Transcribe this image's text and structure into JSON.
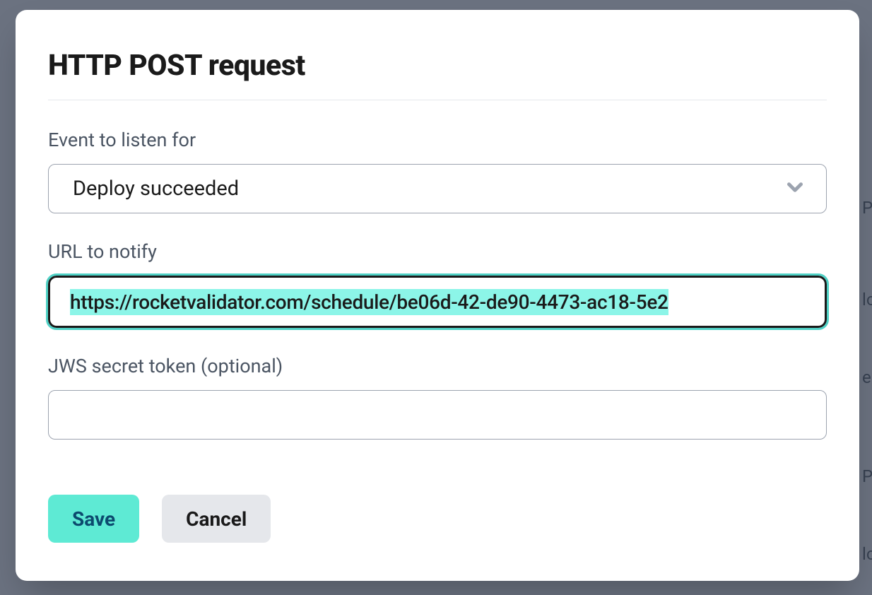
{
  "modal": {
    "title": "HTTP POST request",
    "event_label": "Event to listen for",
    "event_value": "Deploy succeeded",
    "url_label": "URL to notify",
    "url_value": "https://rocketvalidator.com/schedule/be06d-42-de90-4473-ac18-5e2",
    "jws_label": "JWS secret token (optional)",
    "jws_value": "",
    "save_label": "Save",
    "cancel_label": "Cancel"
  }
}
